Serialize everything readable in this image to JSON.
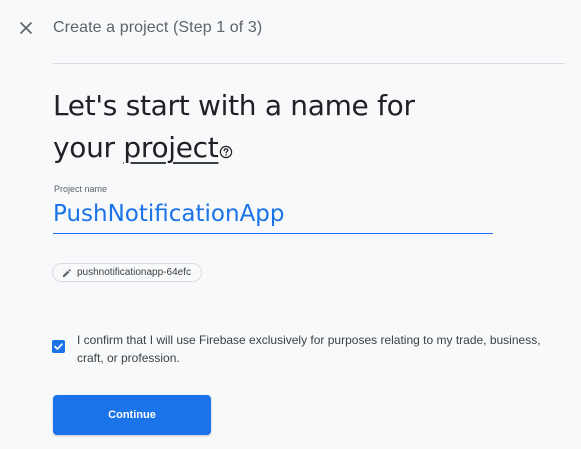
{
  "header": {
    "title": "Create a project (Step 1 of 3)",
    "close_icon": "close-icon"
  },
  "heading": {
    "line1": "Let's start with a name for",
    "line2_prefix": "your ",
    "line2_emphasis": "project",
    "help_icon": "help-circle-icon"
  },
  "project_name": {
    "label": "Project name",
    "value": "PushNotificationApp"
  },
  "project_id": {
    "icon": "pencil-icon",
    "value": "pushnotificationapp-64efc"
  },
  "confirm": {
    "checked": true,
    "text": "I confirm that I will use Firebase exclusively for purposes relating to my trade, business, craft, or profession."
  },
  "actions": {
    "continue_label": "Continue"
  },
  "colors": {
    "accent": "#1a73e8",
    "background": "#f8f9fa",
    "divider": "#dadce0"
  }
}
